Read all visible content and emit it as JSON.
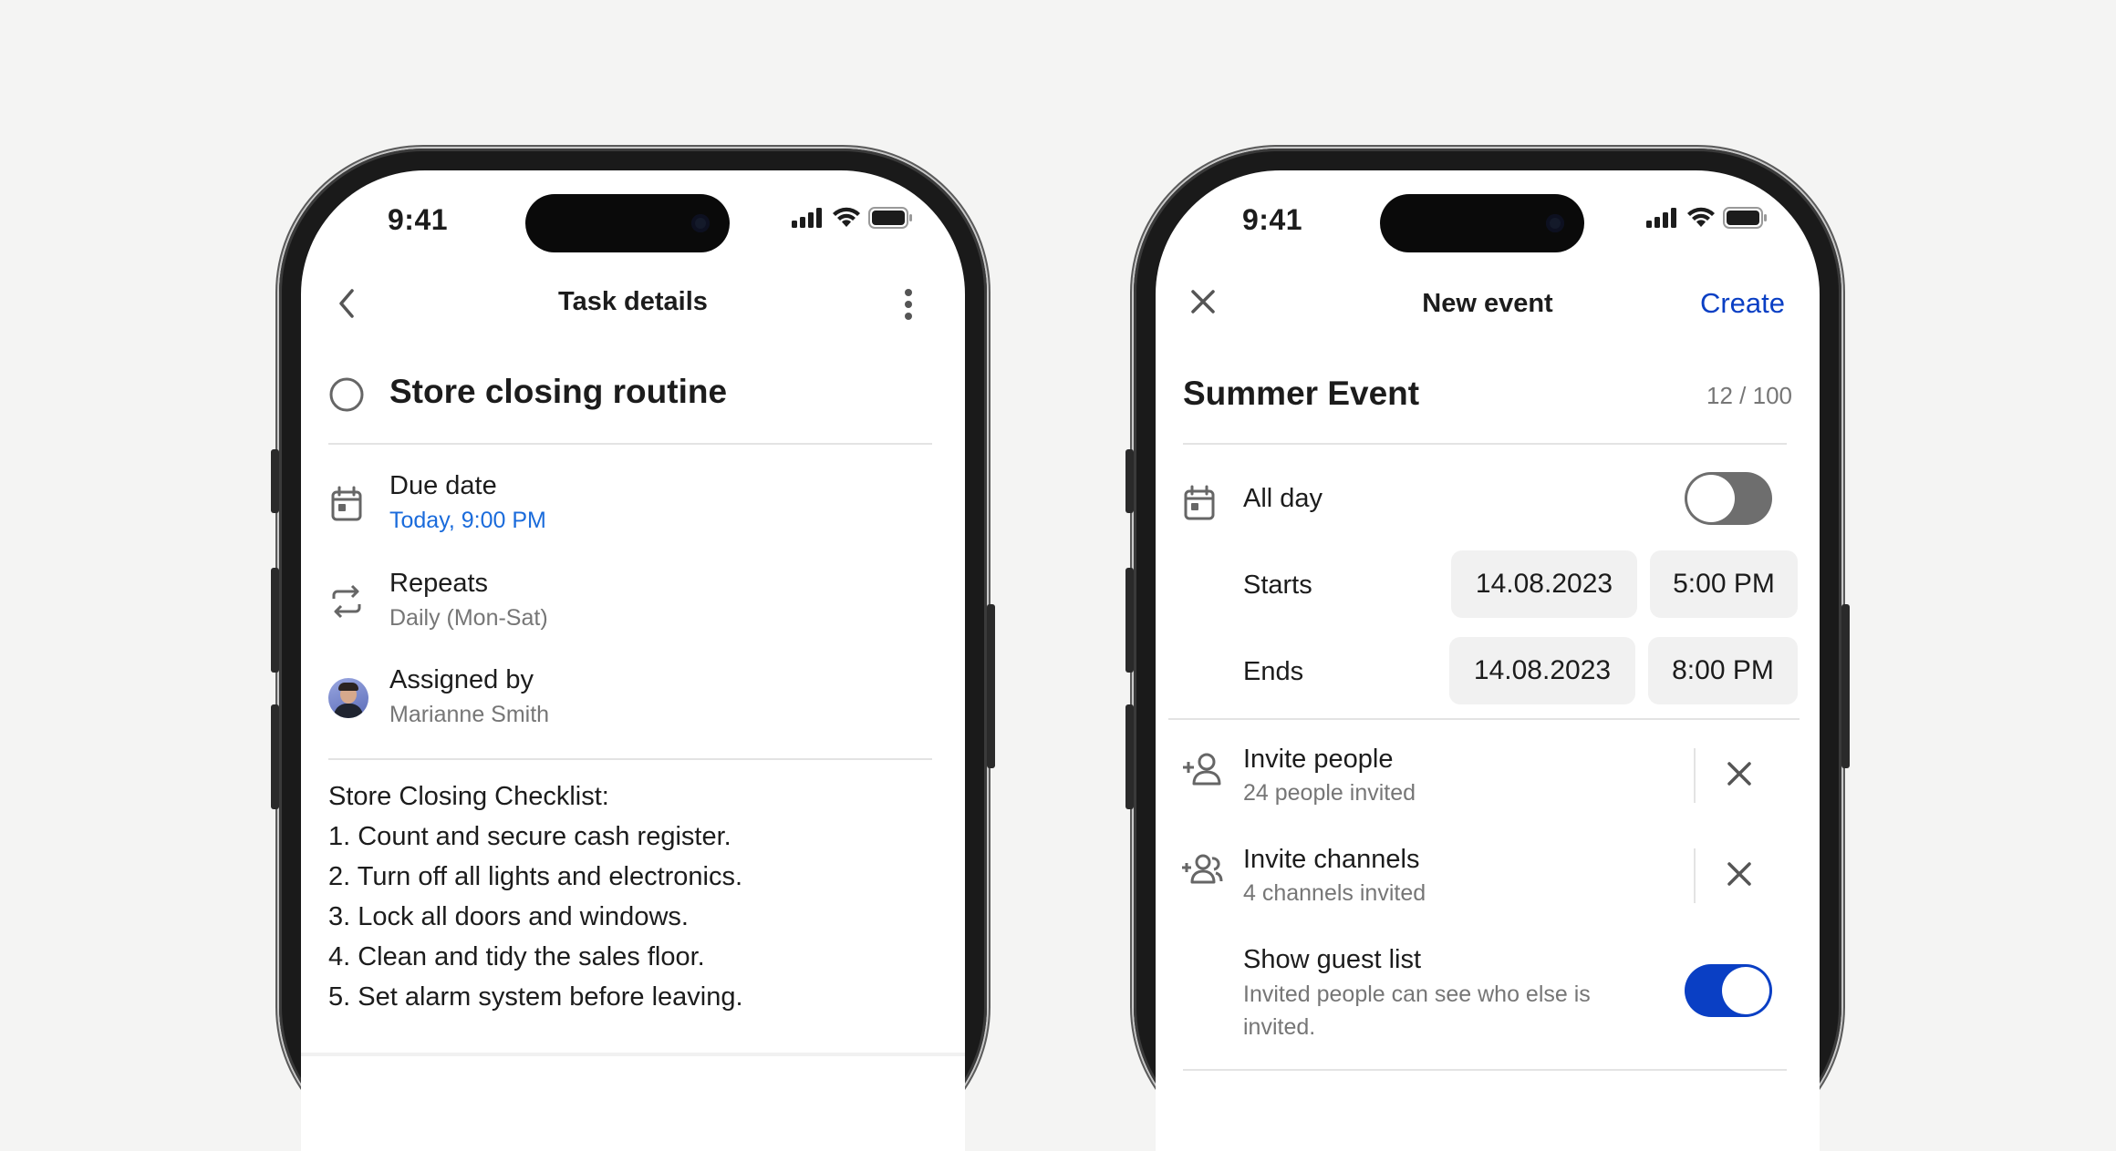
{
  "left": {
    "status": {
      "time": "9:41"
    },
    "header": {
      "title": "Task details"
    },
    "task": {
      "title": "Store closing routine"
    },
    "fields": [
      {
        "label": "Due date",
        "value": "Today, 9:00 PM",
        "icon": "calendar-icon"
      },
      {
        "label": "Repeats",
        "value": "Daily (Mon-Sat)",
        "icon": "repeat-icon"
      },
      {
        "label": "Assigned by",
        "value": "Marianne Smith",
        "icon": "avatar"
      }
    ],
    "notes": [
      "Store Closing Checklist:",
      "1. Count and secure cash register.",
      "2. Turn off all lights and electronics.",
      "3. Lock all doors and windows.",
      "4. Clean and tidy the sales floor.",
      "5. Set alarm system before leaving."
    ]
  },
  "right": {
    "status": {
      "time": "9:41"
    },
    "header": {
      "title": "New event",
      "action": "Create"
    },
    "event": {
      "name": "Summer Event",
      "char_count": "12 / 100"
    },
    "all_day": {
      "label": "All day",
      "on": false
    },
    "starts": {
      "label": "Starts",
      "date": "14.08.2023",
      "time": "5:00 PM"
    },
    "ends": {
      "label": "Ends",
      "date": "14.08.2023",
      "time": "8:00 PM"
    },
    "invite_people": {
      "label": "Invite people",
      "sub": "24 people invited"
    },
    "invite_channels": {
      "label": "Invite channels",
      "sub": "4 channels invited"
    },
    "guest_list": {
      "label": "Show guest list",
      "sub": "Invited people can see who else is",
      "sub2": "invited.",
      "on": true
    }
  },
  "colors": {
    "accent": "#0a3fc4",
    "link": "#1a6bdb",
    "toggle_off": "#6e6e6e"
  }
}
